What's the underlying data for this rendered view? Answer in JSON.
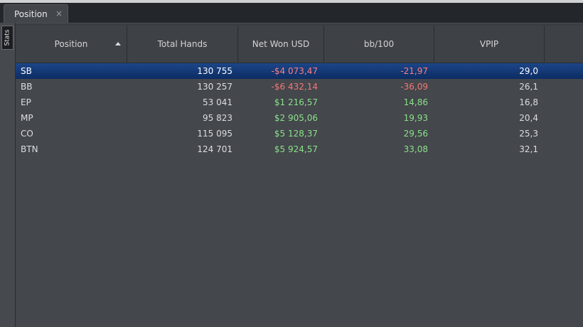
{
  "tab": {
    "label": "Position",
    "close_glyph": "×"
  },
  "sidebar": {
    "tab_label": "Stats"
  },
  "table": {
    "columns": [
      "Position",
      "Total Hands",
      "Net Won USD",
      "bb/100",
      "VPIP"
    ],
    "sort_column": "Position",
    "sort_direction": "ascending",
    "selected_row": 0,
    "rows": [
      {
        "position": "SB",
        "hands": "130 755",
        "net": "-$4 073,47",
        "bb": "-21,97",
        "vpip": "29,0"
      },
      {
        "position": "BB",
        "hands": "130 257",
        "net": "-$6 432,14",
        "bb": "-36,09",
        "vpip": "26,1"
      },
      {
        "position": "EP",
        "hands": "53 041",
        "net": "$1 216,57",
        "bb": "14,86",
        "vpip": "16,8"
      },
      {
        "position": "MP",
        "hands": "95 823",
        "net": "$2 905,06",
        "bb": "19,93",
        "vpip": "20,4"
      },
      {
        "position": "CO",
        "hands": "115 095",
        "net": "$5 128,37",
        "bb": "29,56",
        "vpip": "25,3"
      },
      {
        "position": "BTN",
        "hands": "124 701",
        "net": "$5 924,57",
        "bb": "33,08",
        "vpip": "32,1"
      }
    ]
  },
  "colors": {
    "negative": "#f47777",
    "positive": "#8be18b",
    "selection": "#0c2c63"
  }
}
